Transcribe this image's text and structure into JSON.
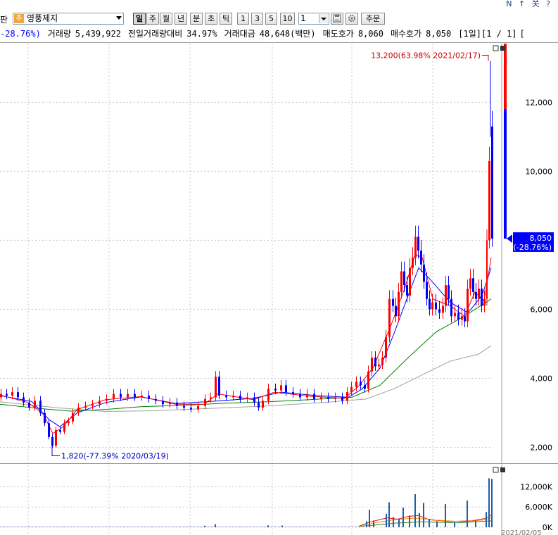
{
  "toolbar": {
    "left_fragment": "판",
    "stock_badge": "주",
    "stock_name": "영풍제지",
    "periods": [
      "일",
      "주",
      "월",
      "년",
      "분",
      "초",
      "틱"
    ],
    "active_period": "일",
    "intervals": [
      "1",
      "3",
      "5",
      "10"
    ],
    "period_value": "1",
    "order_button": "주문",
    "icons": [
      "save-icon",
      "settings-icon"
    ],
    "window_controls": "N ↑ 关 ?"
  },
  "info_bar": {
    "change_rate": "-28.76%)",
    "volume_label": "거래량",
    "volume_value": "5,439,922",
    "prev_volume_ratio_label": "전일거래량대비",
    "prev_volume_ratio_value": "34.97%",
    "trade_amount_label": "거래대금",
    "trade_amount_value": "48,648(백만)",
    "ask_label": "매도호가",
    "ask_value": "8,060",
    "bid_label": "매수호가",
    "bid_value": "8,050",
    "page_info": "[1일][1 / 1]",
    "page_extra": "["
  },
  "colors": {
    "up": "#ff0000",
    "down": "#0000ff",
    "ma5": "#ff0000",
    "ma10": "#0000ff",
    "ma60": "#008000",
    "ma120": "#a0a0a0",
    "current_price_bg": "#0000ff",
    "grid": "#c8c8c8"
  },
  "chart_data": [
    {
      "type": "line",
      "name": "price-chart",
      "ylim": [
        1500,
        13700
      ],
      "y_ticks": [
        2000,
        4000,
        6000,
        8000,
        10000,
        12000
      ],
      "y_tick_labels": [
        "2,000",
        "4,000",
        "6,000",
        "8,000",
        "10,000",
        "12,000"
      ],
      "grid": true,
      "annotations": {
        "high_label": "13,200(63.98% 2021/02/17)",
        "high_value": 13200,
        "low_label": "1,820(-77.39% 2020/03/19)",
        "low_value": 1820,
        "current_price": "8,050",
        "current_change": "(-28.76%)",
        "current_value": 8050
      },
      "price_series": [
        {
          "x": 0,
          "o": 3450,
          "c": 3550
        },
        {
          "x": 8,
          "o": 3550,
          "c": 3500
        },
        {
          "x": 16,
          "o": 3500,
          "c": 3600
        },
        {
          "x": 24,
          "o": 3600,
          "c": 3450
        },
        {
          "x": 32,
          "o": 3450,
          "c": 3300
        },
        {
          "x": 40,
          "o": 3300,
          "c": 3150
        },
        {
          "x": 48,
          "o": 3150,
          "c": 3350
        },
        {
          "x": 56,
          "o": 3350,
          "c": 3000
        },
        {
          "x": 62,
          "o": 3000,
          "c": 2700
        },
        {
          "x": 68,
          "o": 2700,
          "c": 2300
        },
        {
          "x": 73,
          "o": 2300,
          "c": 2050
        },
        {
          "x": 78,
          "o": 2050,
          "c": 2500
        },
        {
          "x": 84,
          "o": 2500,
          "c": 2450
        },
        {
          "x": 90,
          "o": 2450,
          "c": 2700
        },
        {
          "x": 96,
          "o": 2700,
          "c": 2750
        },
        {
          "x": 102,
          "o": 2750,
          "c": 3000
        },
        {
          "x": 110,
          "o": 3000,
          "c": 3150
        },
        {
          "x": 120,
          "o": 3150,
          "c": 3200
        },
        {
          "x": 130,
          "o": 3200,
          "c": 3250
        },
        {
          "x": 140,
          "o": 3250,
          "c": 3350
        },
        {
          "x": 150,
          "o": 3350,
          "c": 3400
        },
        {
          "x": 160,
          "o": 3400,
          "c": 3550
        },
        {
          "x": 170,
          "o": 3550,
          "c": 3450
        },
        {
          "x": 180,
          "o": 3450,
          "c": 3550
        },
        {
          "x": 190,
          "o": 3550,
          "c": 3450
        },
        {
          "x": 200,
          "o": 3450,
          "c": 3500
        },
        {
          "x": 210,
          "o": 3500,
          "c": 3400
        },
        {
          "x": 220,
          "o": 3400,
          "c": 3350
        },
        {
          "x": 230,
          "o": 3350,
          "c": 3250
        },
        {
          "x": 240,
          "o": 3250,
          "c": 3300
        },
        {
          "x": 250,
          "o": 3300,
          "c": 3200
        },
        {
          "x": 260,
          "o": 3200,
          "c": 3150
        },
        {
          "x": 270,
          "o": 3150,
          "c": 3100
        },
        {
          "x": 280,
          "o": 3100,
          "c": 3200
        },
        {
          "x": 290,
          "o": 3200,
          "c": 3400
        },
        {
          "x": 298,
          "o": 3400,
          "c": 3450
        },
        {
          "x": 305,
          "o": 3450,
          "c": 4050
        },
        {
          "x": 310,
          "o": 4050,
          "c": 3500
        },
        {
          "x": 320,
          "o": 3500,
          "c": 3450
        },
        {
          "x": 330,
          "o": 3450,
          "c": 3500
        },
        {
          "x": 340,
          "o": 3500,
          "c": 3400
        },
        {
          "x": 350,
          "o": 3400,
          "c": 3450
        },
        {
          "x": 360,
          "o": 3450,
          "c": 3300
        },
        {
          "x": 366,
          "o": 3300,
          "c": 3150
        },
        {
          "x": 372,
          "o": 3150,
          "c": 3350
        },
        {
          "x": 380,
          "o": 3350,
          "c": 3700
        },
        {
          "x": 390,
          "o": 3700,
          "c": 3650
        },
        {
          "x": 398,
          "o": 3650,
          "c": 3800
        },
        {
          "x": 405,
          "o": 3800,
          "c": 3600
        },
        {
          "x": 415,
          "o": 3600,
          "c": 3550
        },
        {
          "x": 425,
          "o": 3550,
          "c": 3450
        },
        {
          "x": 435,
          "o": 3450,
          "c": 3550
        },
        {
          "x": 445,
          "o": 3550,
          "c": 3400
        },
        {
          "x": 455,
          "o": 3400,
          "c": 3450
        },
        {
          "x": 465,
          "o": 3450,
          "c": 3400
        },
        {
          "x": 475,
          "o": 3400,
          "c": 3450
        },
        {
          "x": 485,
          "o": 3450,
          "c": 3350
        },
        {
          "x": 492,
          "o": 3350,
          "c": 3600
        },
        {
          "x": 498,
          "o": 3600,
          "c": 3750
        },
        {
          "x": 505,
          "o": 3750,
          "c": 3900
        },
        {
          "x": 511,
          "o": 3900,
          "c": 3800
        },
        {
          "x": 517,
          "o": 3800,
          "c": 3700
        },
        {
          "x": 522,
          "o": 3700,
          "c": 4200
        },
        {
          "x": 527,
          "o": 4200,
          "c": 4600
        },
        {
          "x": 532,
          "o": 4600,
          "c": 4350
        },
        {
          "x": 537,
          "o": 4350,
          "c": 4400
        },
        {
          "x": 542,
          "o": 4400,
          "c": 4600
        },
        {
          "x": 547,
          "o": 4600,
          "c": 5200
        },
        {
          "x": 552,
          "o": 5200,
          "c": 6300
        },
        {
          "x": 557,
          "o": 6300,
          "c": 6100
        },
        {
          "x": 561,
          "o": 6100,
          "c": 5800
        },
        {
          "x": 565,
          "o": 5800,
          "c": 6500
        },
        {
          "x": 569,
          "o": 6500,
          "c": 7100
        },
        {
          "x": 573,
          "o": 7100,
          "c": 6700
        },
        {
          "x": 577,
          "o": 6700,
          "c": 6400
        },
        {
          "x": 581,
          "o": 6400,
          "c": 7200
        },
        {
          "x": 585,
          "o": 7200,
          "c": 7500
        },
        {
          "x": 589,
          "o": 7500,
          "c": 8100
        },
        {
          "x": 593,
          "o": 8100,
          "c": 7700
        },
        {
          "x": 597,
          "o": 7700,
          "c": 7300
        },
        {
          "x": 601,
          "o": 7300,
          "c": 6800
        },
        {
          "x": 605,
          "o": 6800,
          "c": 6300
        },
        {
          "x": 609,
          "o": 6300,
          "c": 6000
        },
        {
          "x": 613,
          "o": 6000,
          "c": 6200
        },
        {
          "x": 618,
          "o": 6200,
          "c": 6000
        },
        {
          "x": 623,
          "o": 6000,
          "c": 5900
        },
        {
          "x": 628,
          "o": 5900,
          "c": 6100
        },
        {
          "x": 632,
          "o": 6100,
          "c": 6700
        },
        {
          "x": 636,
          "o": 6700,
          "c": 6300
        },
        {
          "x": 640,
          "o": 6300,
          "c": 5800
        },
        {
          "x": 645,
          "o": 5800,
          "c": 5900
        },
        {
          "x": 650,
          "o": 5900,
          "c": 5700
        },
        {
          "x": 655,
          "o": 5700,
          "c": 5800
        },
        {
          "x": 659,
          "o": 5800,
          "c": 5650
        },
        {
          "x": 663,
          "o": 5650,
          "c": 6600
        },
        {
          "x": 667,
          "o": 6600,
          "c": 6900
        },
        {
          "x": 671,
          "o": 6900,
          "c": 6500
        },
        {
          "x": 675,
          "o": 6500,
          "c": 6300
        },
        {
          "x": 679,
          "o": 6300,
          "c": 6600
        },
        {
          "x": 683,
          "o": 6600,
          "c": 6100
        },
        {
          "x": 687,
          "o": 6100,
          "c": 6300
        },
        {
          "x": 691,
          "o": 6300,
          "c": 8000
        },
        {
          "x": 694,
          "o": 8000,
          "c": 10300
        },
        {
          "x": 698,
          "o": 11300,
          "c": 8050
        }
      ],
      "ma5": [
        [
          0,
          3520
        ],
        [
          40,
          3300
        ],
        [
          62,
          2950
        ],
        [
          75,
          2400
        ],
        [
          90,
          2600
        ],
        [
          110,
          3100
        ],
        [
          150,
          3380
        ],
        [
          200,
          3470
        ],
        [
          250,
          3250
        ],
        [
          290,
          3250
        ],
        [
          310,
          3550
        ],
        [
          360,
          3380
        ],
        [
          390,
          3600
        ],
        [
          440,
          3480
        ],
        [
          490,
          3420
        ],
        [
          510,
          3780
        ],
        [
          530,
          4300
        ],
        [
          555,
          5500
        ],
        [
          575,
          6600
        ],
        [
          590,
          7600
        ],
        [
          600,
          7500
        ],
        [
          615,
          6300
        ],
        [
          640,
          6100
        ],
        [
          660,
          5800
        ],
        [
          675,
          6500
        ],
        [
          688,
          6250
        ],
        [
          698,
          7500
        ]
      ],
      "ma10": [
        [
          0,
          3500
        ],
        [
          45,
          3330
        ],
        [
          70,
          2800
        ],
        [
          85,
          2600
        ],
        [
          110,
          3000
        ],
        [
          150,
          3300
        ],
        [
          200,
          3460
        ],
        [
          250,
          3270
        ],
        [
          300,
          3330
        ],
        [
          360,
          3420
        ],
        [
          400,
          3600
        ],
        [
          450,
          3500
        ],
        [
          495,
          3450
        ],
        [
          515,
          3700
        ],
        [
          540,
          4300
        ],
        [
          560,
          5300
        ],
        [
          580,
          6400
        ],
        [
          595,
          7200
        ],
        [
          610,
          6900
        ],
        [
          640,
          6200
        ],
        [
          665,
          5900
        ],
        [
          685,
          6400
        ],
        [
          698,
          7200
        ]
      ],
      "ma60": [
        [
          0,
          3250
        ],
        [
          60,
          3120
        ],
        [
          100,
          3050
        ],
        [
          150,
          3100
        ],
        [
          200,
          3180
        ],
        [
          260,
          3220
        ],
        [
          320,
          3280
        ],
        [
          380,
          3320
        ],
        [
          440,
          3380
        ],
        [
          500,
          3450
        ],
        [
          540,
          3800
        ],
        [
          580,
          4600
        ],
        [
          620,
          5350
        ],
        [
          660,
          5800
        ],
        [
          698,
          6300
        ]
      ],
      "ma120": [
        [
          0,
          3320
        ],
        [
          80,
          3150
        ],
        [
          150,
          3040
        ],
        [
          220,
          3060
        ],
        [
          300,
          3130
        ],
        [
          380,
          3200
        ],
        [
          460,
          3300
        ],
        [
          520,
          3400
        ],
        [
          560,
          3700
        ],
        [
          600,
          4100
        ],
        [
          640,
          4500
        ],
        [
          680,
          4700
        ],
        [
          698,
          4950
        ]
      ]
    },
    {
      "type": "bar",
      "name": "volume-chart",
      "ylim": [
        0,
        15000
      ],
      "y_ticks": [
        0,
        6000,
        12000
      ],
      "y_tick_labels": [
        "0K",
        "6,000K",
        "12,000K"
      ],
      "volumes": [
        {
          "x": 290,
          "v": 450
        },
        {
          "x": 305,
          "v": 900
        },
        {
          "x": 380,
          "v": 550
        },
        {
          "x": 400,
          "v": 500
        },
        {
          "x": 520,
          "v": 1800
        },
        {
          "x": 524,
          "v": 5200
        },
        {
          "x": 530,
          "v": 2000
        },
        {
          "x": 548,
          "v": 4000
        },
        {
          "x": 552,
          "v": 7400
        },
        {
          "x": 558,
          "v": 3000
        },
        {
          "x": 566,
          "v": 2500
        },
        {
          "x": 572,
          "v": 5800
        },
        {
          "x": 581,
          "v": 3500
        },
        {
          "x": 589,
          "v": 9800
        },
        {
          "x": 595,
          "v": 4200
        },
        {
          "x": 601,
          "v": 7200
        },
        {
          "x": 609,
          "v": 2500
        },
        {
          "x": 620,
          "v": 1800
        },
        {
          "x": 632,
          "v": 6900
        },
        {
          "x": 645,
          "v": 1500
        },
        {
          "x": 663,
          "v": 7900
        },
        {
          "x": 675,
          "v": 2000
        },
        {
          "x": 690,
          "v": 4500
        },
        {
          "x": 694,
          "v": 14500
        },
        {
          "x": 698,
          "v": 14300
        }
      ],
      "vol_ma_series": [
        [
          [
            510,
            300
          ],
          [
            525,
            1500
          ],
          [
            550,
            2800
          ],
          [
            565,
            2400
          ],
          [
            580,
            3200
          ],
          [
            595,
            3500
          ],
          [
            610,
            2200
          ],
          [
            640,
            1700
          ],
          [
            670,
            1900
          ],
          [
            690,
            2600
          ],
          [
            698,
            3600
          ]
        ],
        [
          [
            510,
            250
          ],
          [
            530,
            1200
          ],
          [
            560,
            2200
          ],
          [
            590,
            2700
          ],
          [
            620,
            2100
          ],
          [
            660,
            1600
          ],
          [
            690,
            2200
          ],
          [
            698,
            2800
          ]
        ],
        [
          [
            510,
            200
          ],
          [
            560,
            1200
          ],
          [
            600,
            1600
          ],
          [
            650,
            1300
          ],
          [
            698,
            1900
          ]
        ]
      ],
      "x_tick_labels": [
        "2021/02/05"
      ]
    }
  ]
}
